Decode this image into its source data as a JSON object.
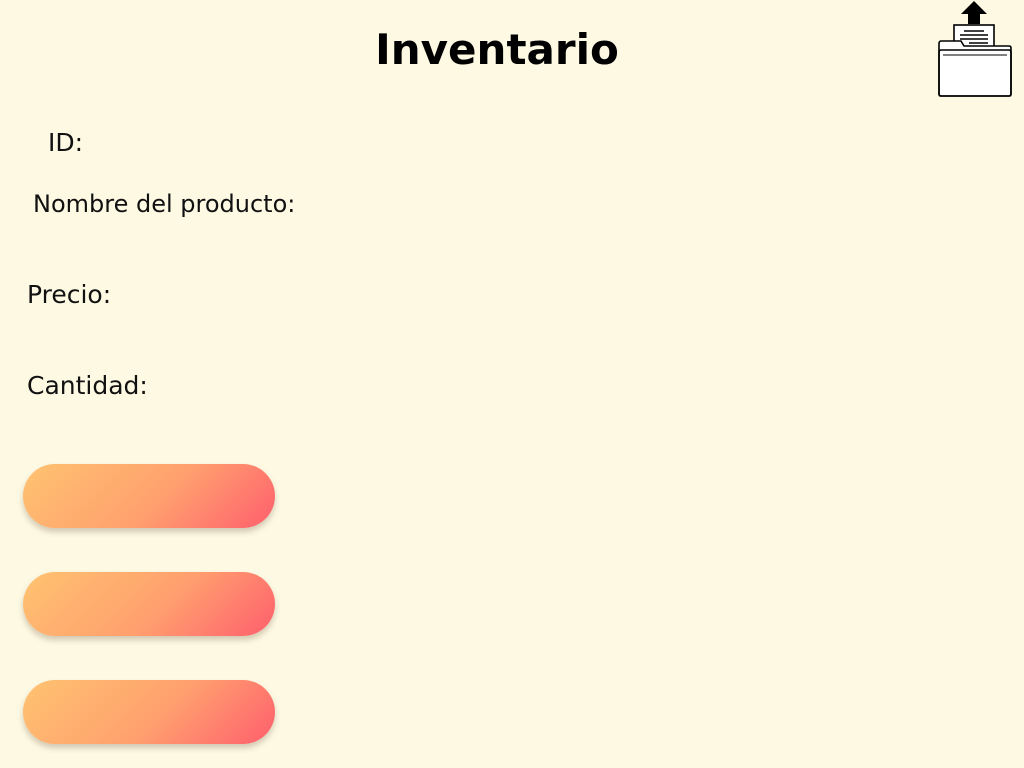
{
  "header": {
    "title": "Inventario",
    "export_icon": "folder-upload-icon"
  },
  "form": {
    "id_label": "ID:",
    "name_label": "Nombre del producto:",
    "price_label": "Precio:",
    "quantity_label": "Cantidad:"
  },
  "actions": {
    "button_1_label": "",
    "button_2_label": "",
    "button_3_label": "",
    "gradient_start": "#ffc371",
    "gradient_end": "#ff5f6d"
  },
  "theme": {
    "background": "#fdf9e3",
    "text": "#111111"
  }
}
